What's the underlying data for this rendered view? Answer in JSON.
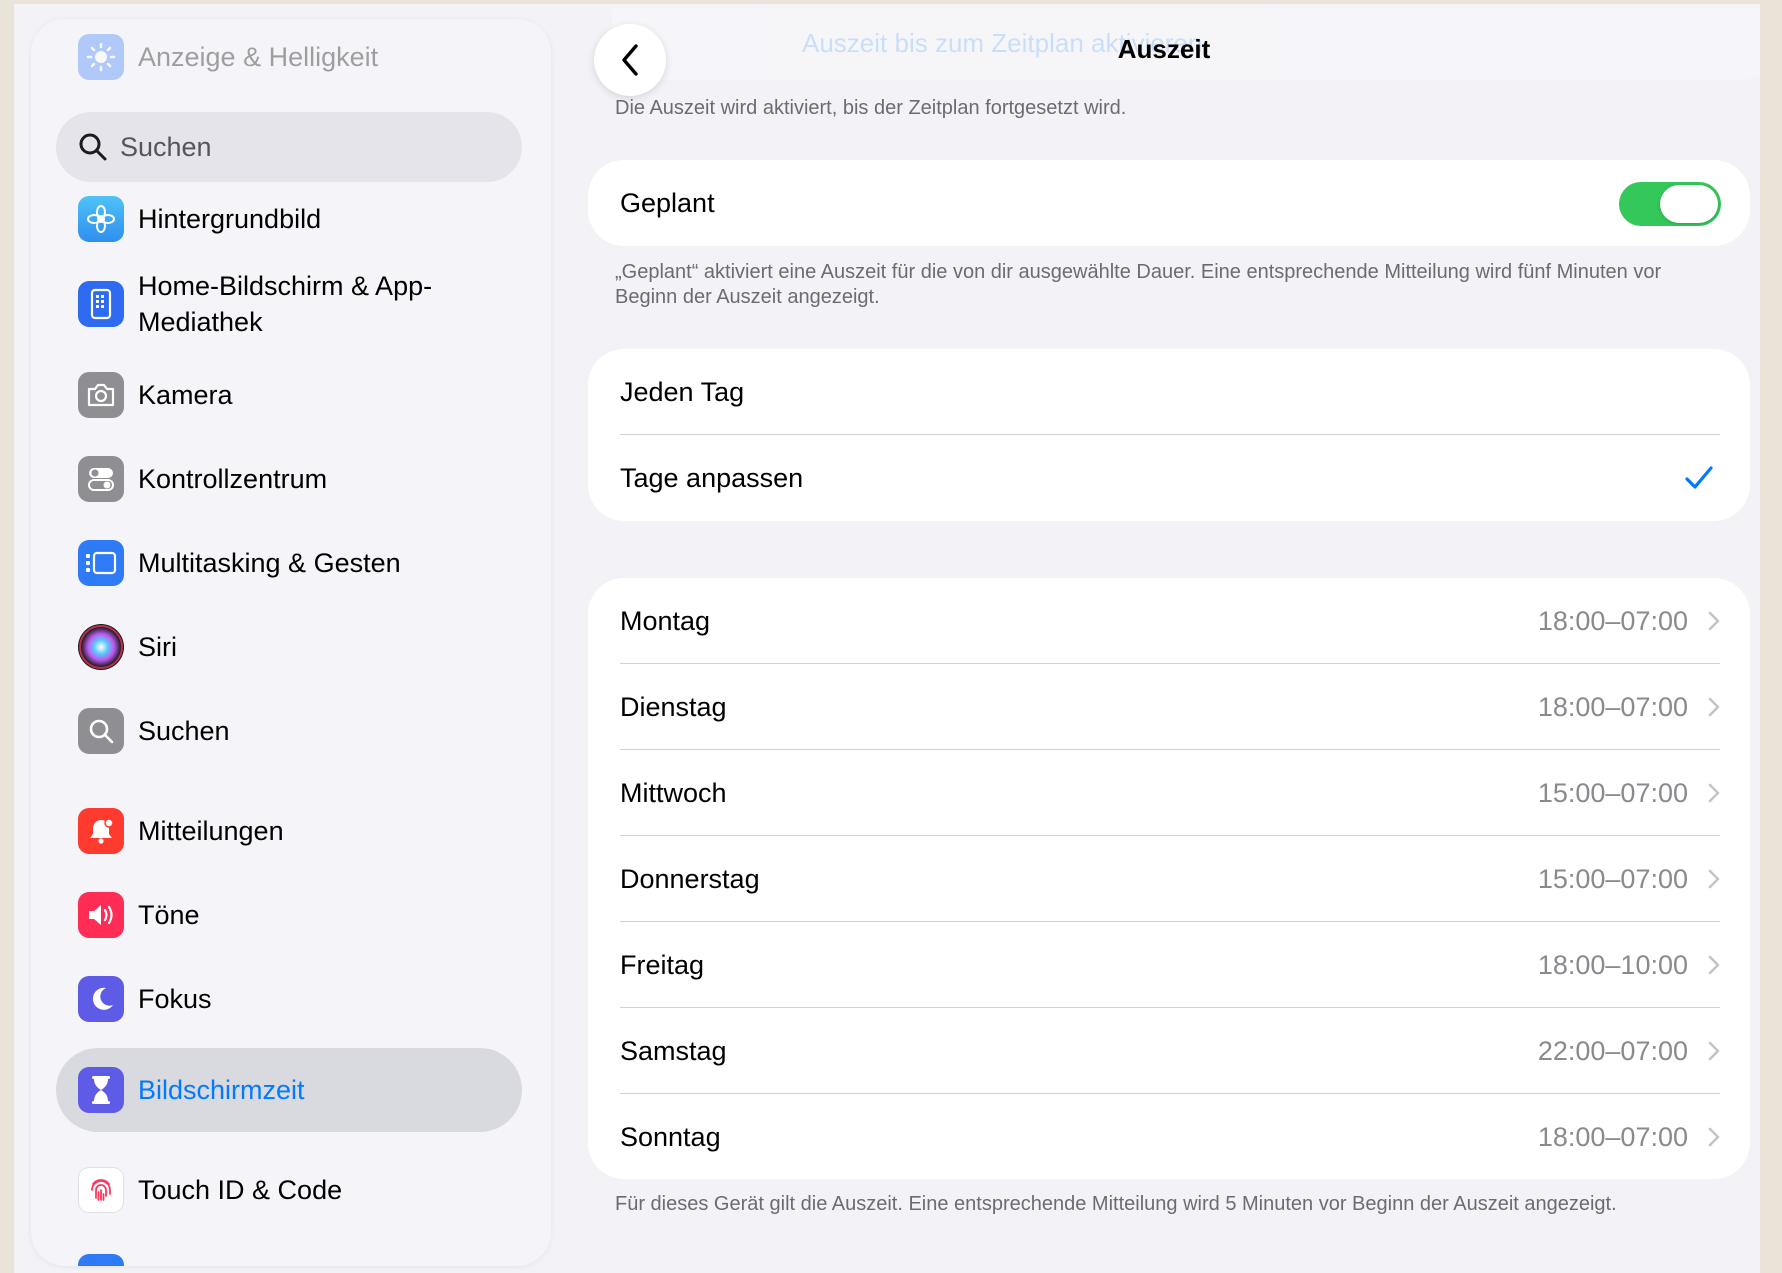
{
  "sidebar": {
    "faded_top_label": "Anzeige & Helligkeit",
    "search_placeholder": "Suchen",
    "items": [
      {
        "label": "Hintergrundbild",
        "icon": "flower-icon",
        "color": "#3fa9f5"
      },
      {
        "label_line1": "Home-Bildschirm & App-",
        "label_line2": "Mediathek",
        "icon": "home-screen-icon",
        "color": "#2f6bf0"
      },
      {
        "label": "Kamera",
        "icon": "camera-icon",
        "color": "#8e8e93"
      },
      {
        "label": "Kontrollzentrum",
        "icon": "toggles-icon",
        "color": "#8e8e93"
      },
      {
        "label": "Multitasking & Gesten",
        "icon": "multitasking-icon",
        "color": "#2f7bf5"
      },
      {
        "label": "Siri",
        "icon": "siri-icon",
        "color": "#1c1c1e"
      },
      {
        "label": "Suchen",
        "icon": "search-icon",
        "color": "#8e8e93"
      },
      {
        "label": "Mitteilungen",
        "icon": "bell-icon",
        "color": "#ff3b30"
      },
      {
        "label": "Töne",
        "icon": "speaker-icon",
        "color": "#ff2d55"
      },
      {
        "label": "Fokus",
        "icon": "moon-icon",
        "color": "#5e5ce6"
      },
      {
        "label": "Bildschirmzeit",
        "icon": "hourglass-icon",
        "color": "#5e5ce6",
        "selected": true
      },
      {
        "label": "Touch ID & Code",
        "icon": "fingerprint-icon",
        "color": "#ffffff"
      }
    ]
  },
  "main": {
    "title": "Auszeit",
    "faded_top_label": "Auszeit bis zum Zeitplan aktivieren",
    "top_footnote": "Die Auszeit wird aktiviert, bis der Zeitplan fortgesetzt wird.",
    "scheduled": {
      "label": "Geplant",
      "on": true
    },
    "scheduled_footnote": "„Geplant“ aktiviert eine Auszeit für die von dir ausgewählte Dauer. Eine entsprechende Mitteilung wird fünf Minuten vor Beginn der Auszeit angezeigt.",
    "mode_options": [
      {
        "label": "Jeden Tag",
        "checked": false
      },
      {
        "label": "Tage anpassen",
        "checked": true
      }
    ],
    "days": [
      {
        "label": "Montag",
        "value": "18:00–07:00"
      },
      {
        "label": "Dienstag",
        "value": "18:00–07:00"
      },
      {
        "label": "Mittwoch",
        "value": "15:00–07:00"
      },
      {
        "label": "Donnerstag",
        "value": "15:00–07:00"
      },
      {
        "label": "Freitag",
        "value": "18:00–10:00"
      },
      {
        "label": "Samstag",
        "value": "22:00–07:00"
      },
      {
        "label": "Sonntag",
        "value": "18:00–07:00"
      }
    ],
    "bottom_footnote": "Für dieses Gerät gilt die Auszeit. Eine entsprechende Mitteilung wird 5 Minuten vor Beginn der Auszeit angezeigt."
  }
}
